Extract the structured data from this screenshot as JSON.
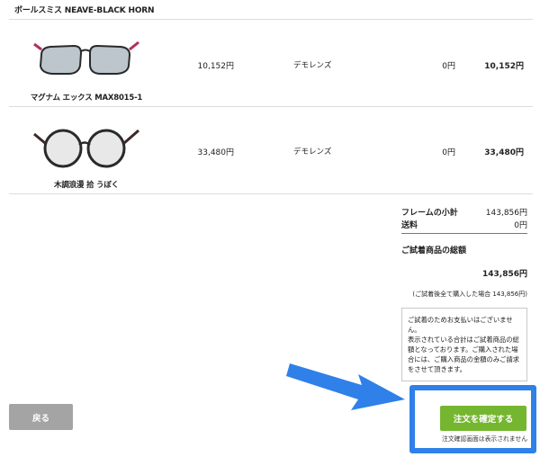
{
  "top_item": {
    "name": "ボールスミス NEAVE-BLACK HORN"
  },
  "items": [
    {
      "name": "マグナム エックス MAX8015-1",
      "frame_price": "10,152円",
      "lens": "デモレンズ",
      "lens_price": "0円",
      "total": "10,152円",
      "image": "glasses-rectangular-icon"
    },
    {
      "name": "木調浪漫 拾 うぼく",
      "frame_price": "33,480円",
      "lens": "デモレンズ",
      "lens_price": "0円",
      "total": "33,480円",
      "image": "glasses-round-icon"
    }
  ],
  "summary": {
    "frame_subtotal_label": "フレームの小計",
    "frame_subtotal": "143,856円",
    "shipping_label": "送料",
    "shipping": "0円",
    "grand_label": "ご試着商品の総額",
    "grand_total": "143,856円",
    "purchase_note": "(ご試着後全て購入した場合 143,856円)"
  },
  "notice": {
    "lines": [
      "ご試着のためお支払いはございませ",
      "ん。",
      "表示されている合計はご試着商品の総",
      "額となっております。ご購入された場",
      "合には、ご購入商品の金額のみご請求",
      "をさせて頂きます。"
    ]
  },
  "buttons": {
    "back": "戻る",
    "confirm": "注文を確定する",
    "confirm_note": "注文確認画面は表示されません"
  },
  "colors": {
    "confirm_button": "#75b630",
    "back_button": "#a4a4a4",
    "highlight_border": "#2f80e8",
    "arrow": "#2f80e8"
  }
}
